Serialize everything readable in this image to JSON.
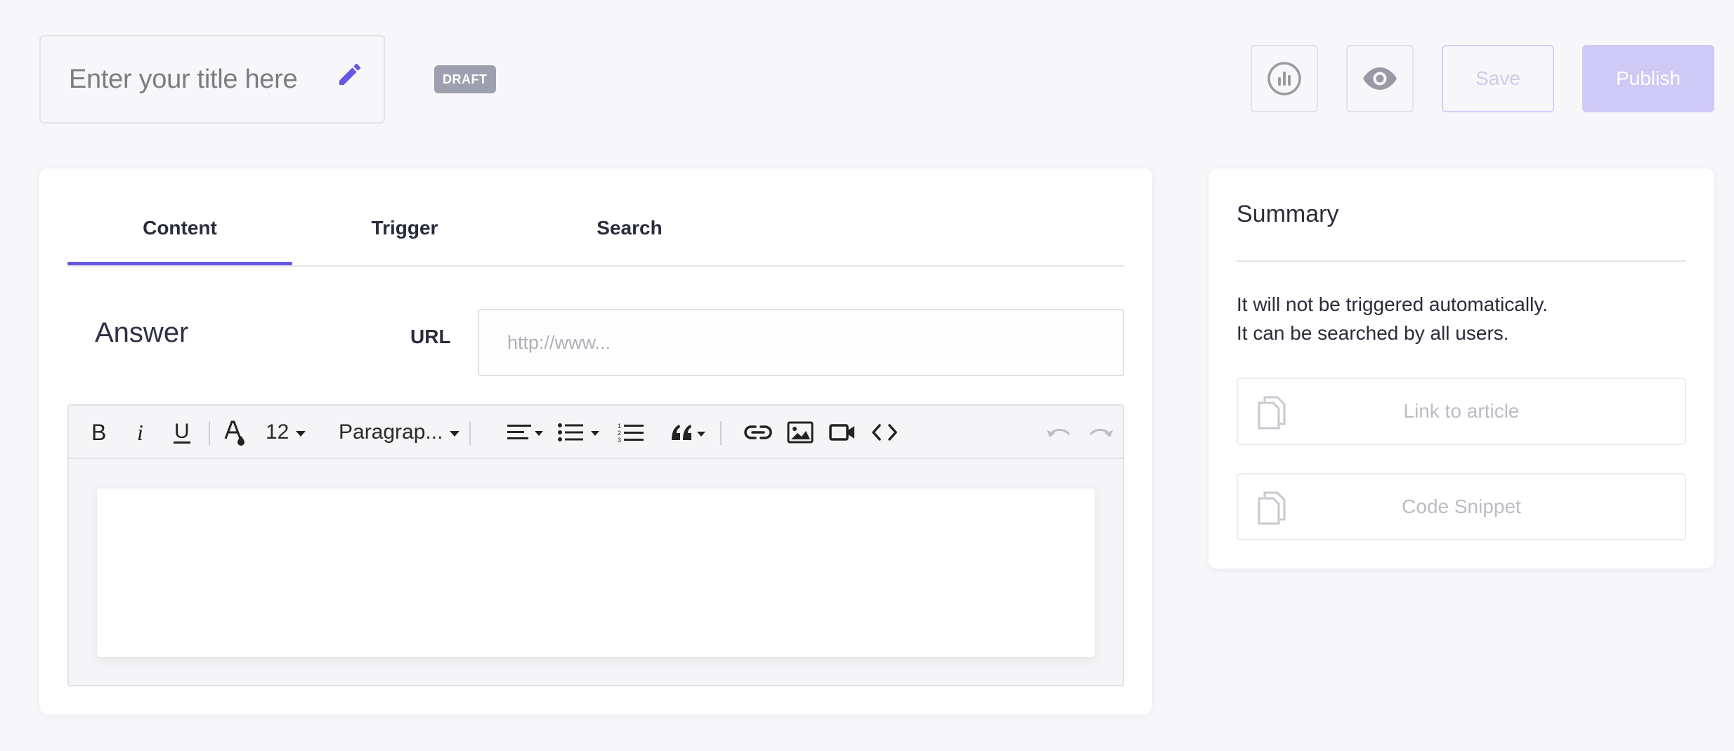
{
  "header": {
    "title_placeholder": "Enter your title here",
    "status_badge": "DRAFT",
    "save_label": "Save",
    "publish_label": "Publish",
    "icons": {
      "edit": "pencil-icon",
      "analytics": "bar-chart-icon",
      "preview": "eye-icon"
    }
  },
  "tabs": [
    {
      "label": "Content",
      "active": true
    },
    {
      "label": "Trigger",
      "active": false
    },
    {
      "label": "Search",
      "active": false
    }
  ],
  "answer": {
    "heading": "Answer",
    "url_label": "URL",
    "url_placeholder": "http://www..."
  },
  "editor": {
    "font_size": "12",
    "block_format": "Paragrap...",
    "toolbar_icons": [
      "bold-icon",
      "italic-icon",
      "underline-icon",
      "text-color-icon",
      "align-icon",
      "bullet-list-icon",
      "numbered-list-icon",
      "quote-icon",
      "link-icon",
      "image-icon",
      "video-icon",
      "code-icon",
      "undo-icon",
      "redo-icon"
    ]
  },
  "summary": {
    "title": "Summary",
    "lines": [
      "It will not be triggered automatically.",
      "It can be searched by all users."
    ],
    "link_article_label": "Link to article",
    "code_snippet_label": "Code Snippet"
  },
  "colors": {
    "accent": "#6658e0",
    "publish_bg": "#cfc9f5",
    "badge_bg": "#9da0ae",
    "page_bg": "#f7f7fa"
  }
}
